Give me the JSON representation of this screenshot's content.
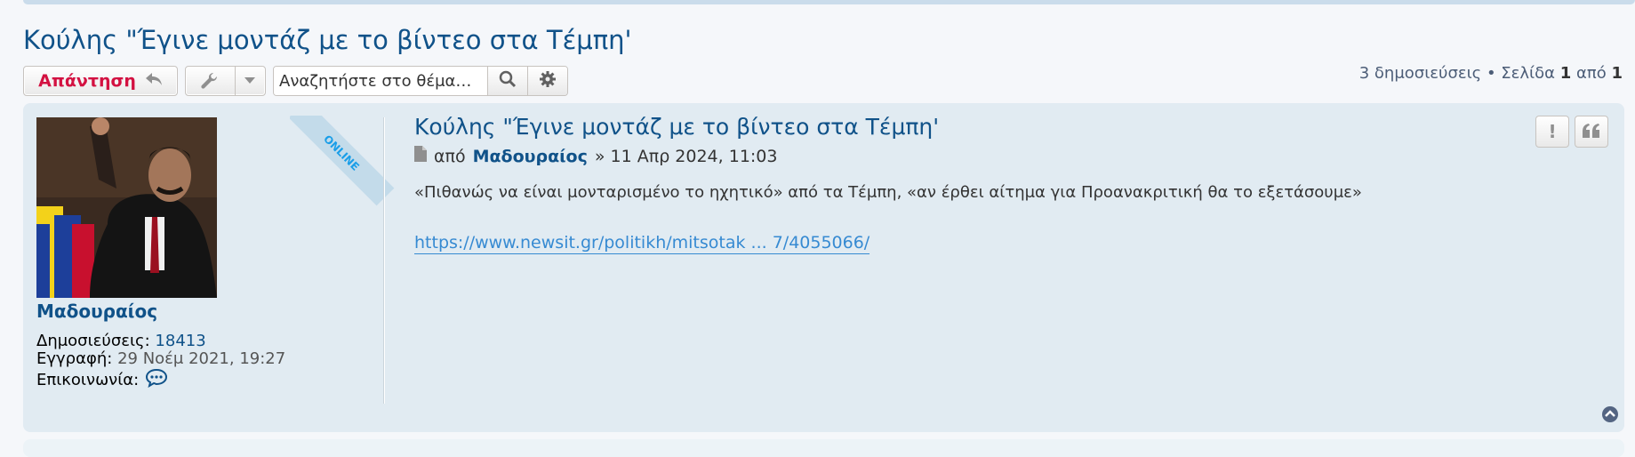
{
  "topic": {
    "title": "Κούλης \"Έγινε μοντάζ με το βίντεο στα Τέμπη'"
  },
  "actions": {
    "reply_label": "Απάντηση",
    "search_placeholder": "Αναζητήστε στο θέμα…"
  },
  "pagination": {
    "posts_text": "3 δημοσιεύσεις • Σελίδα",
    "current_page": "1",
    "of_text": "από",
    "total_pages": "1"
  },
  "post": {
    "online_label": "ONLINE",
    "username": "Μαδουραίος",
    "posts_label": "Δημοσιεύσεις:",
    "posts_count": "18413",
    "joined_label": "Εγγραφή:",
    "joined_date": "29 Νοέμ 2021, 19:27",
    "contact_label": "Επικοινωνία:",
    "title": "Κούλης \"Έγινε μοντάζ με το βίντεο στα Τέμπη'",
    "by_label": "από",
    "author": "Μαδουραίος",
    "date_text": "» 11 Απρ 2024, 11:03",
    "body": "«Πιθανώς να είναι μονταρισμένο το ηχητικό» από τα Τέμπη, «αν έρθει αίτημα για Προανακριτική θα το εξετάσουμε»",
    "link": "https://www.newsit.gr/politikh/mitsotak ... 7/4055066/",
    "report_label": "!"
  },
  "colors": {
    "link_blue": "#105289",
    "reply_red": "#d31141",
    "post_bg": "#e1ebf2",
    "online_blue": "#1a9ee8"
  }
}
